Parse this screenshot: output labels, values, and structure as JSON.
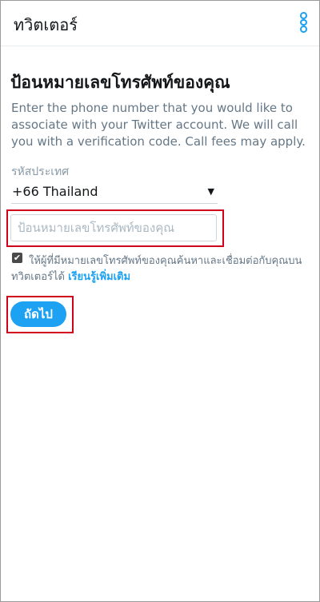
{
  "appbar": {
    "title": "ทวิตเตอร์",
    "menu_icon": "more-vertical-icon"
  },
  "main": {
    "heading": "ป้อนหมายเลขโทรศัพท์ของคุณ",
    "description": "Enter the phone number that you would like to associate with your Twitter account. We will call you with a verification code. Call fees may apply.",
    "country_label": "รหัสประเทศ",
    "country_value": "+66 Thailand",
    "phone_placeholder": "ป้อนหมายเลขโทรศัพท์ของคุณ",
    "phone_value": "",
    "consent_checked": true,
    "consent_text": "ให้ผู้ที่มีหมายเลขโทรศัพท์ของคุณค้นหาและเชื่อมต่อกับคุณบนทวิตเตอร์ได้",
    "learn_more": "เรียนรู้เพิ่มเติม",
    "next_label": "ถัดไป"
  },
  "colors": {
    "accent": "#1da1f2",
    "highlight": "#d0021b"
  }
}
